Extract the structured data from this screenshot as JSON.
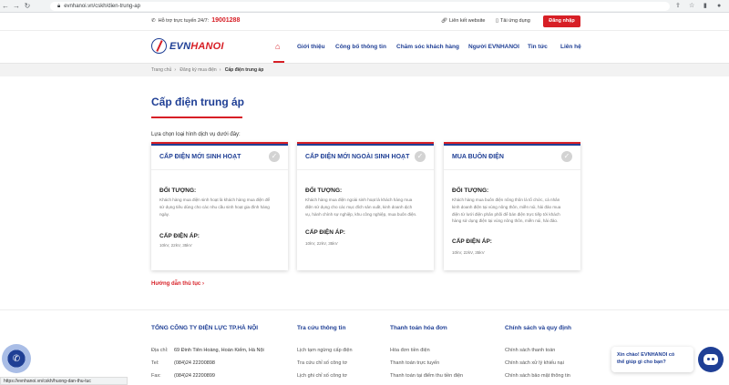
{
  "browser": {
    "url": "evnhanoi.vn/cskh/dien-trung-ap",
    "status_url": "https://evnhanoi.vn/cskh/huong-dan-thu-tuc"
  },
  "topbar": {
    "hotline_label": "Hỗ trợ trực tuyến 24/7:",
    "hotline_number": "19001288",
    "link_website": "Liên kết website",
    "link_download": "Tải ứng dụng",
    "login": "Đăng nhập"
  },
  "logo": {
    "evn": "EVN",
    "hanoi": "HANOI"
  },
  "nav": [
    "Giới thiệu",
    "Công bố thông tin",
    "Chăm sóc khách hàng",
    "Người EVNHANOI",
    "Tin tức",
    "Liên hệ"
  ],
  "breadcrumb": [
    "Trang chủ",
    "Đăng ký mua điện",
    "Cấp điện trung áp"
  ],
  "main": {
    "title": "Cấp điện trung áp",
    "intro": "Lựa chọn loại hình dịch vụ dưới đây:",
    "guide_link": "Hướng dẫn thủ tục"
  },
  "cards": [
    {
      "title": "CẤP ĐIỆN MỚI SINH HOẠT",
      "object_h": "ĐỐI TƯỢNG:",
      "object_lines": [
        "Khách hàng mua điện sinh hoạt là khách hàng mua điện để",
        "sử dụng tiêu dùng cho các nhu cầu sinh hoạt gia đình hàng",
        "ngày."
      ],
      "voltage_h": "CẤP ĐIỆN ÁP:",
      "voltage": "10kV, 22kV, 35kV"
    },
    {
      "title": "CẤP ĐIỆN MỚI NGOÀI SINH HOẠT",
      "object_h": "ĐỐI TƯỢNG:",
      "object_lines": [
        "Khách hàng mua điện ngoài sinh hoạt là khách hàng mua",
        "điện sử dụng cho các mục đích sản xuất, kinh doanh dịch",
        "vụ, hành chính sự nghiệp, khu công nghiệp, mua buôn điện."
      ],
      "voltage_h": "CẤP ĐIỆN ÁP:",
      "voltage": "10kV, 22kV, 35kV"
    },
    {
      "title": "MUA BUÔN ĐIỆN",
      "object_h": "ĐỐI TƯỢNG:",
      "object_lines": [
        "Khách hàng mua buôn điện nông thôn là tổ chức, cá nhân",
        "kinh doanh điện tại vùng nông thôn, miền núi, hải đảo mua",
        "điện từ lưới điện phân phối để bán điện trực tiếp tới khách",
        "hàng sử dụng điện tại vùng nông thôn, miền núi, hải đảo."
      ],
      "voltage_h": "CẤP ĐIỆN ÁP:",
      "voltage": "10kV, 22kV, 35kV"
    }
  ],
  "footer": {
    "company": "TỔNG CÔNG TY ĐIỆN LỰC TP.HÀ NỘI",
    "address_label": "Địa chỉ:",
    "address": "69 Đinh Tiên Hoàng, Hoàn Kiếm, Hà Nội",
    "tel_label": "Tel:",
    "tel": "(084)24 22200898",
    "fax_label": "Fax:",
    "fax": "(084)24 22200899",
    "col2_h": "Tra cứu thông tin",
    "col2": [
      "Lịch tạm ngừng cấp điện",
      "Tra cứu chỉ số công tơ",
      "Lịch ghi chỉ số công tơ"
    ],
    "col3_h": "Thanh toán hóa đơn",
    "col3": [
      "Hóa đơn tiền điện",
      "Thanh toán trực tuyến",
      "Thanh toán tại điểm thu tiền điện"
    ],
    "col4_h": "Chính sách và quy định",
    "col4": [
      "Chính sách thanh toán",
      "Chính sách xử lý khiếu nại",
      "Chính sách bảo mật thông tin"
    ]
  },
  "chat": {
    "greeting_1": "Xin chào! EVNHANOI có",
    "greeting_2": "thể giúp gì cho bạn?"
  },
  "colors": {
    "brand_blue": "#1f3f95",
    "brand_red": "#d71f26"
  }
}
